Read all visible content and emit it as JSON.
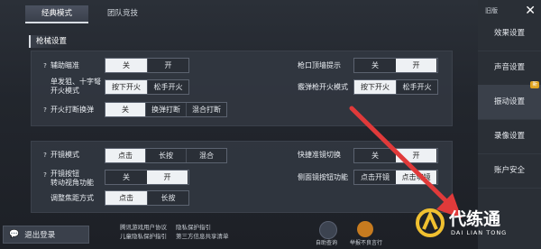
{
  "tabs": [
    {
      "label": "经典模式"
    },
    {
      "label": "团队竞技"
    }
  ],
  "top_right_label": "旧版",
  "section_title": "枪械设置",
  "panel1": {
    "rows": [
      {
        "label": "辅助瞄准",
        "options": [
          "关",
          "开"
        ],
        "selected": 0
      },
      {
        "label": "单发狙、十字弩\n开火模式",
        "options": [
          "按下开火",
          "松手开火"
        ],
        "selected": 0
      },
      {
        "label": "开火打断换弹",
        "options": [
          "关",
          "换弹打断",
          "混合打断"
        ],
        "selected": 0
      },
      {
        "label": "枪口顶墙提示",
        "options": [
          "关",
          "开"
        ],
        "selected": 1
      },
      {
        "label": "霰弹枪开火模式",
        "options": [
          "按下开火",
          "松手开火"
        ],
        "selected": 0
      }
    ]
  },
  "panel2": {
    "rows": [
      {
        "label": "开镜模式",
        "options": [
          "点击",
          "长按",
          "混合"
        ],
        "selected": 0
      },
      {
        "label": "开镜按钮\n转动视角功能",
        "options": [
          "关",
          "开"
        ],
        "selected": 1
      },
      {
        "label": "调整焦距方式",
        "options": [
          "点击",
          "长按"
        ],
        "selected": 0
      },
      {
        "label": "快捷准镜切换",
        "options": [
          "关",
          "开"
        ],
        "selected": 1
      },
      {
        "label": "侧面镜按钮功能",
        "options": [
          "点击开镜",
          "点击切镜"
        ],
        "selected": 1
      }
    ]
  },
  "sidebar": [
    {
      "label": "效果设置"
    },
    {
      "label": "声音设置"
    },
    {
      "label": "振动设置",
      "badge": "新"
    },
    {
      "label": "录像设置"
    },
    {
      "label": "账户安全"
    }
  ],
  "exit_button": "退出登录",
  "footer_links": [
    "腾讯游戏用户协议",
    "隐私保护指引",
    "儿童隐私保护指引",
    "第三方信息共享清单"
  ],
  "footer_icons": [
    {
      "label": "自助查询"
    },
    {
      "label": "举报不良言行"
    }
  ],
  "watermark": {
    "text": "代练通",
    "sub": "DAI LIAN TONG"
  },
  "colors": {
    "accent": "#e0a420",
    "arrow": "#e03a3a"
  }
}
